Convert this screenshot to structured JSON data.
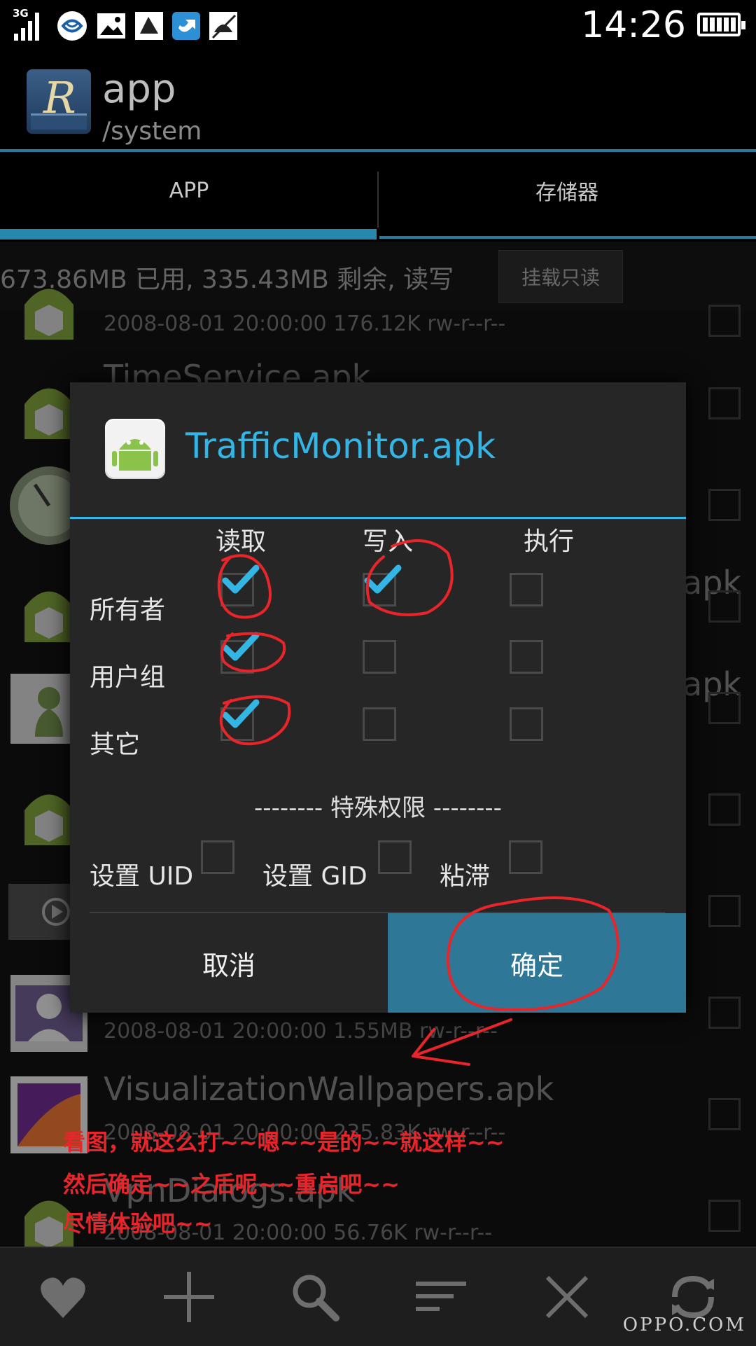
{
  "status_bar": {
    "network": "3G",
    "time": "14:26"
  },
  "action_bar": {
    "title": "app",
    "subtitle": "/system",
    "logo_letter": "R"
  },
  "tabs": [
    {
      "label": "APP",
      "active": true
    },
    {
      "label": "存储器",
      "active": false
    }
  ],
  "storage": {
    "info": "673.86MB 已用, 335.43MB 剩余, 读写",
    "mount_button": "挂载只读"
  },
  "file_list": [
    {
      "name": "",
      "meta": "2008-08-01 20:00:00  176.12K  rw-r--r--"
    },
    {
      "name": "TimeService.apk",
      "meta": ""
    },
    {
      "name": "",
      "meta": ""
    },
    {
      "name": "apk",
      "meta": ""
    },
    {
      "name": "apk",
      "meta": ""
    },
    {
      "name": "",
      "meta": ""
    },
    {
      "name": "",
      "meta": ""
    },
    {
      "name": "",
      "meta": "2008-08-01 20:00:00  1.55MB  rw-r--r--"
    },
    {
      "name": "VisualizationWallpapers.apk",
      "meta": "2008-08-01 20:00:00  235.83K  rw-r--r--"
    },
    {
      "name": "VpnDialogs.apk",
      "meta": "2008-08-01 20:00:00  56.76K  rw-r--r--"
    }
  ],
  "dialog": {
    "title": "TrafficMonitor.apk",
    "columns": [
      "读取",
      "写入",
      "执行"
    ],
    "rows": [
      {
        "label": "所有者",
        "checks": [
          true,
          true,
          false
        ]
      },
      {
        "label": "用户组",
        "checks": [
          true,
          false,
          false
        ]
      },
      {
        "label": "其它",
        "checks": [
          true,
          false,
          false
        ]
      }
    ],
    "special_title": "-------- 特殊权限 --------",
    "special": [
      {
        "label": "设置 UID",
        "checked": false
      },
      {
        "label": "设置 GID",
        "checked": false
      },
      {
        "label": "粘滞",
        "checked": false
      }
    ],
    "cancel_label": "取消",
    "ok_label": "确定"
  },
  "annotations": [
    "看图，就这么打~~嗯~~是的~~就这样~~",
    "然后确定~~之后呢~~重启吧~~",
    "尽情体验吧~~"
  ],
  "toolbar": {
    "icons": [
      "heart-icon",
      "plus-icon",
      "search-icon",
      "sort-icon",
      "close-icon",
      "refresh-icon"
    ]
  },
  "watermark": "OPPO.COM",
  "colors": {
    "accent": "#33b5e5",
    "ok_button": "#2f7796",
    "annotation": "#e8252a"
  }
}
